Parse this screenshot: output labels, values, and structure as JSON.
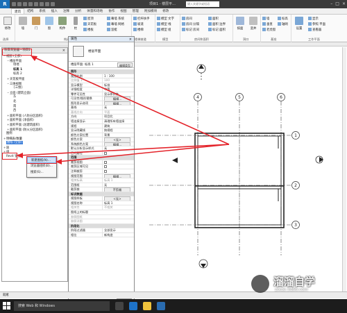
{
  "titlebar": {
    "logo": "R",
    "title": "项目1 - 楼层平...",
    "search_placeholder": "键入关键字或短语"
  },
  "ribbon_tabs": [
    "建筑",
    "结构",
    "系统",
    "插入",
    "注释",
    "分析",
    "体量和场地",
    "协作",
    "视图",
    "管理",
    "附加模块",
    "修改"
  ],
  "ribbon": {
    "big_buttons": [
      "修改",
      "墙",
      "门",
      "窗",
      "构件",
      "柱"
    ],
    "build_small": [
      "屋顶",
      "天花板",
      "楼板",
      "幕墙 系统",
      "幕墙 网格",
      "竖梃"
    ],
    "circulation_small": [
      "栏杆扶手",
      "坡道",
      "楼梯"
    ],
    "model_small": [
      "模型 文字",
      "模型 线",
      "模型 组"
    ],
    "room_small": [
      "房间",
      "房间 分隔",
      "标记 房间",
      "面积",
      "面积 边界",
      "标记 面积"
    ],
    "opening_big": [
      "按面",
      "竖井"
    ],
    "datum_small": [
      "墙",
      "垂直",
      "老虎窗",
      "标高",
      "轴网"
    ],
    "workplane_small": [
      "显示",
      "参照 平面",
      "查看器"
    ],
    "workplane_big": "设置",
    "group_labels": [
      "选择",
      "构建",
      "楼梯坡道",
      "模型",
      "房间和面积",
      "洞口",
      "基准",
      "工作平面"
    ]
  },
  "project_browser": {
    "title": "项目浏览器 - 项目1",
    "items": [
      {
        "indent": 0,
        "twisty": "−",
        "label": "视图 (全部)"
      },
      {
        "indent": 1,
        "twisty": "−",
        "label": "楼层平面"
      },
      {
        "indent": 2,
        "twisty": "",
        "label": "场地"
      },
      {
        "indent": 2,
        "twisty": "",
        "label": "标高 1",
        "bold": true
      },
      {
        "indent": 2,
        "twisty": "",
        "label": "标高 2"
      },
      {
        "indent": 1,
        "twisty": "+",
        "label": "天花板平面"
      },
      {
        "indent": 1,
        "twisty": "−",
        "label": "三维视图"
      },
      {
        "indent": 2,
        "twisty": "",
        "label": "{三维}"
      },
      {
        "indent": 1,
        "twisty": "−",
        "label": "立面 (建筑立面)"
      },
      {
        "indent": 2,
        "twisty": "",
        "label": "东"
      },
      {
        "indent": 2,
        "twisty": "",
        "label": "北"
      },
      {
        "indent": 2,
        "twisty": "",
        "label": "南"
      },
      {
        "indent": 2,
        "twisty": "",
        "label": "西"
      },
      {
        "indent": 1,
        "twisty": "+",
        "label": "面积平面 (人防分区面积)"
      },
      {
        "indent": 1,
        "twisty": "+",
        "label": "面积平面 (净面积)"
      },
      {
        "indent": 1,
        "twisty": "+",
        "label": "面积平面 (总建筑面积)"
      },
      {
        "indent": 1,
        "twisty": "+",
        "label": "面积平面 (防火分区面积)"
      },
      {
        "indent": 0,
        "twisty": "",
        "label": "图例"
      },
      {
        "indent": 0,
        "twisty": "+",
        "label": "明细表/数量"
      },
      {
        "indent": 0,
        "twisty": "",
        "label": "图纸 (全部)",
        "selected": true
      },
      {
        "indent": 0,
        "twisty": "+",
        "label": "族"
      },
      {
        "indent": 0,
        "twisty": "+",
        "label": "组"
      },
      {
        "indent": 0,
        "twisty": "",
        "label": "Revit 链接"
      }
    ]
  },
  "context_menu": {
    "items": [
      "新建图纸(N)...",
      "浏览器组织(B)...",
      "搜索(S)..."
    ]
  },
  "properties": {
    "title": "属性",
    "type_label": "楼层平面",
    "selector": "楼层平面: 标高 1",
    "edit_type": "编辑类型",
    "sections": [
      {
        "header": "图形",
        "rows": [
          [
            "视图比例",
            "1 : 100",
            "input"
          ],
          [
            "比例值 1:",
            "100",
            "grey"
          ],
          [
            "显示模型",
            "标准",
            ""
          ],
          [
            "详细程度",
            "中等",
            ""
          ],
          [
            "零件可见性",
            "显示原状态",
            ""
          ],
          [
            "可见性/图形替换",
            "编辑...",
            "btn"
          ],
          [
            "图形显示选项",
            "编辑...",
            "btn"
          ],
          [
            "基线",
            "无",
            ""
          ],
          [
            "基线方向",
            "平面",
            "grey"
          ],
          [
            "方向",
            "项目北",
            ""
          ],
          [
            "墙连接显示",
            "清理所有墙连接",
            ""
          ],
          [
            "规程",
            "建筑",
            ""
          ],
          [
            "显示隐藏线",
            "按规程",
            ""
          ],
          [
            "颜色方案位置",
            "背景",
            ""
          ],
          [
            "颜色方案",
            "<无>",
            "btn"
          ],
          [
            "系统颜色方案",
            "编辑...",
            "btn"
          ],
          [
            "默认分析显示样式",
            "无",
            ""
          ],
          [
            "日光路径",
            "",
            "chk"
          ]
        ]
      },
      {
        "header": "范围",
        "rows": [
          [
            "裁剪视图",
            "",
            "chk"
          ],
          [
            "裁剪区域可见",
            "",
            "chk"
          ],
          [
            "注释裁剪",
            "",
            "chk"
          ],
          [
            "视图范围",
            "编辑...",
            "btn"
          ],
          [
            "相关标高",
            "标高 1",
            "grey"
          ],
          [
            "范围框",
            "无",
            ""
          ],
          [
            "截剪裁",
            "不剪裁",
            "btn"
          ]
        ]
      },
      {
        "header": "标识数据",
        "rows": [
          [
            "视图样板",
            "<无>",
            "btn"
          ],
          [
            "视图名称",
            "标高 1",
            ""
          ],
          [
            "相关性",
            "不相关",
            "grey"
          ],
          [
            "图纸上的标题",
            "",
            ""
          ],
          [
            "参照图纸",
            "",
            "grey"
          ],
          [
            "参照详图",
            "",
            "grey"
          ]
        ]
      },
      {
        "header": "阶段化",
        "rows": [
          [
            "阶段过滤器",
            "全部显示",
            ""
          ],
          [
            "相位",
            "新构造",
            ""
          ]
        ]
      }
    ],
    "help_link": "属性帮助",
    "apply": "应用"
  },
  "grid_labels": [
    "4",
    "5",
    "6",
    "1",
    "2",
    "3"
  ],
  "statusbar": {
    "text": "就绪"
  },
  "taskbar": {
    "search_text": "搜索 Web 和 Windows"
  },
  "watermark": {
    "name": "溜溜自学",
    "url": "zixue.3d66.com"
  },
  "colors": {
    "accent": "#e4232a",
    "selection": "#3b7dd8",
    "ribbon_bg": "#fafafa"
  }
}
